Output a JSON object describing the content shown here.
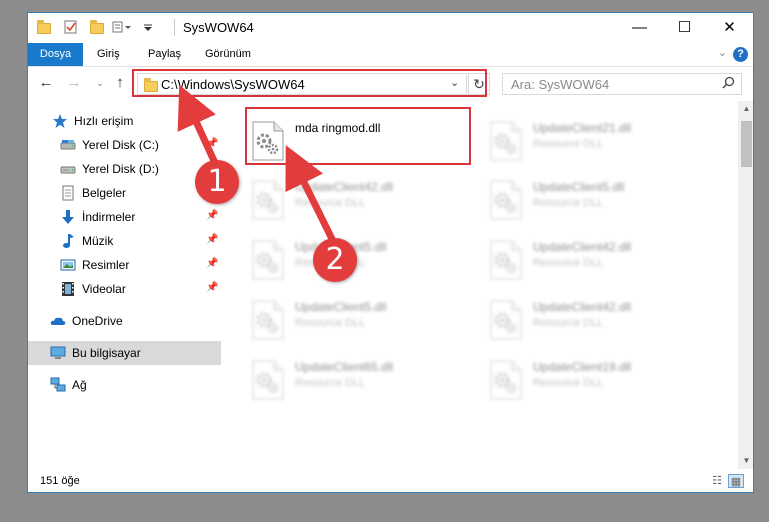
{
  "window": {
    "title": "SysWOW64",
    "controls": {
      "minimize": "—",
      "maximize": "☐",
      "close": "✕"
    }
  },
  "ribbon": {
    "tabs": [
      {
        "label": "Dosya"
      },
      {
        "label": "Giriş"
      },
      {
        "label": "Paylaş"
      },
      {
        "label": "Görünüm"
      }
    ],
    "help": "?"
  },
  "address": {
    "path": "C:\\Windows\\SysWOW64",
    "search_placeholder": "Ara: SysWOW64"
  },
  "sidebar": {
    "items": [
      {
        "label": "Hızlı erişim",
        "icon": "star-icon"
      },
      {
        "label": "Yerel Disk (C:)",
        "icon": "drive-icon",
        "pinned": true
      },
      {
        "label": "Yerel Disk (D:)",
        "icon": "drive-icon"
      },
      {
        "label": "Belgeler",
        "icon": "documents-icon"
      },
      {
        "label": "İndirmeler",
        "icon": "download-icon",
        "pinned": true
      },
      {
        "label": "Müzik",
        "icon": "music-icon",
        "pinned": true
      },
      {
        "label": "Resimler",
        "icon": "pictures-icon",
        "pinned": true
      },
      {
        "label": "Videolar",
        "icon": "video-icon",
        "pinned": true
      },
      {
        "label": "OneDrive",
        "icon": "onedrive-icon"
      },
      {
        "label": "Bu bilgisayar",
        "icon": "computer-icon",
        "selected": true
      },
      {
        "label": "Ağ",
        "icon": "network-icon"
      }
    ]
  },
  "files": [
    {
      "name": "mda ringmod.dll",
      "type": ""
    },
    {
      "name": "UpdateClient21.dll",
      "type": "Resource DLL"
    },
    {
      "name": "UpdateClient42.dll",
      "type": "Resource DLL"
    },
    {
      "name": "UpdateClient5.dll",
      "type": "Resource DLL"
    },
    {
      "name": "UpdateClient5.dll",
      "type": "Resource DLL"
    },
    {
      "name": "UpdateClient42.dll",
      "type": "Resource DLL"
    },
    {
      "name": "UpdateClient5.dll",
      "type": "Resource DLL"
    },
    {
      "name": "UpdateClient42.dll",
      "type": "Resource DLL"
    },
    {
      "name": "UpdateClient65.dll",
      "type": "Resource DLL"
    },
    {
      "name": "UpdateClient19.dll",
      "type": "Resource DLL"
    }
  ],
  "status": {
    "item_count": "151 öğe"
  },
  "annotations": {
    "step1": "1",
    "step2": "2",
    "color": "#d8353a"
  }
}
